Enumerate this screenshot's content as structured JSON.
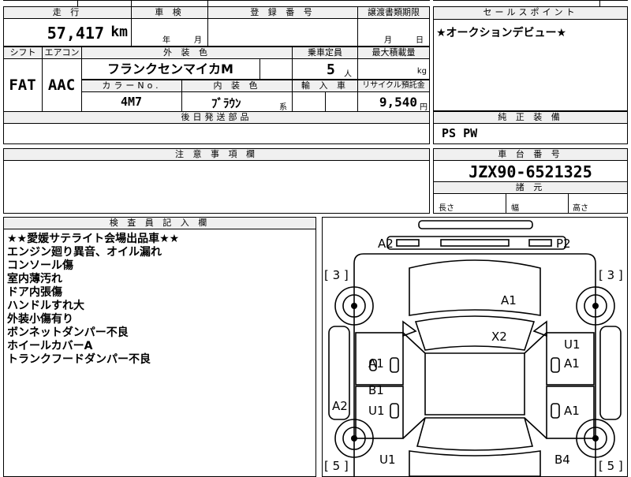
{
  "top_row": {
    "mileage_header": "走 行",
    "mileage_value": "57,417",
    "mileage_unit": "km",
    "inspection_header": "車 検",
    "inspection_year": "年",
    "inspection_month": "月",
    "registration_header": "登 録 番 号",
    "transfer_header": "譲渡書類期限",
    "transfer_month": "月",
    "transfer_day": "日",
    "sales_point_header": "セールスポイント",
    "sales_point_text": "★オークションデビュー★"
  },
  "row2": {
    "shift_header": "シフト",
    "shift_value": "FAT",
    "aircon_header": "エアコン",
    "aircon_value": "AAC",
    "exterior_color_header": "外 装 色",
    "exterior_color_value": "フランクセンマイカM",
    "capacity_header": "乗車定員",
    "capacity_value": "5",
    "capacity_unit": "人",
    "max_load_header": "最大積載量",
    "max_load_unit": "kg",
    "color_no_header": "カラーNo.",
    "color_no_value": "4M7",
    "interior_color_header": "内 装 色",
    "interior_color_value": "ﾌﾞﾗｳﾝ",
    "interior_color_suffix": "系",
    "import_header": "輸 入 車",
    "recycle_header": "リサイクル預託金",
    "recycle_value": "9,540",
    "recycle_unit": "円"
  },
  "later_parts_header": "後日発送部品",
  "genuine_equipment_header": "純 正 装 備",
  "genuine_equipment_value": "PS PW",
  "caution_header": "注 意 事 項 欄",
  "chassis_header": "車 台 番 号",
  "chassis_value": "JZX90-6521325",
  "dimensions_header": "諸 元",
  "dim_length": "長さ",
  "dim_width": "幅",
  "dim_height": "高さ",
  "inspector_header": "検 査 員 記 入 欄",
  "inspector_notes": [
    "★★愛媛サテライト会場出品車★★",
    "エンジン廻り異音、オイル漏れ",
    "コンソール傷",
    "室内薄汚れ",
    "ドア内張傷",
    "ハンドルすれ大",
    "外装小傷有り",
    "ボンネットダンパー不良",
    "ホイールカバーA",
    "トランクフードダンパー不良"
  ],
  "diagram_labels": {
    "front_left": "A2",
    "front_right": "P2",
    "tire_fl": "[ 3 ]",
    "tire_fr": "[ 3 ]",
    "hood": "A1",
    "windshield": "X2",
    "front_door_left_1": "A1",
    "front_door_right_1": "U1",
    "front_door_right_2": "A1",
    "rear_door_left_1": "B1",
    "rear_door_left_2": "U1",
    "rocker_left": "A2",
    "rear_door_right": "A1",
    "rear_quarter_left": "U1",
    "rear_quarter_right": "B4",
    "tire_rl": "[ 5 ]",
    "tire_rr": "[ 5 ]"
  }
}
